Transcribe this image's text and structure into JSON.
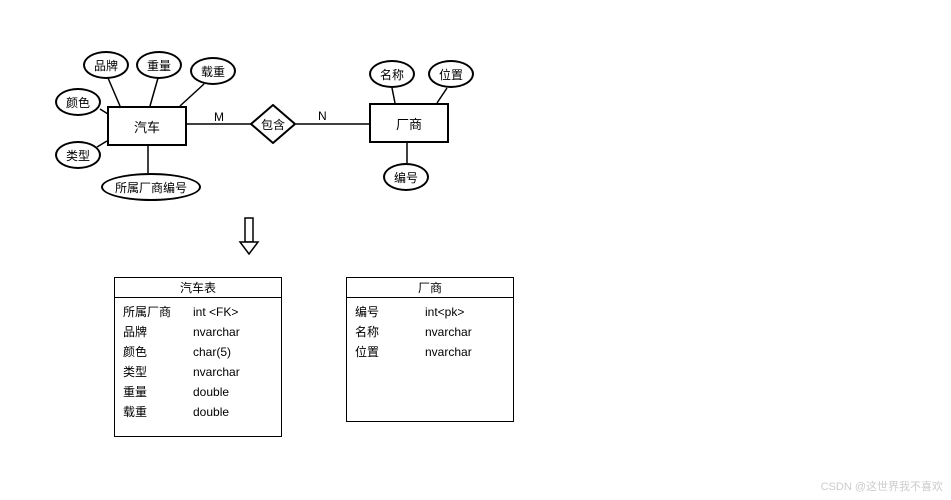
{
  "er": {
    "entities": {
      "car": "汽车",
      "vendor": "厂商"
    },
    "relationship": {
      "label": "包含",
      "left_card": "M",
      "right_card": "N"
    },
    "attrs": {
      "car": {
        "brand": "品牌",
        "weight": "重量",
        "capacity": "载重",
        "color": "颜色",
        "type": "类型",
        "vendor_fk": "所属厂商编号"
      },
      "vendor": {
        "name": "名称",
        "location": "位置",
        "id": "编号"
      }
    }
  },
  "tables": {
    "car": {
      "title": "汽车表",
      "cols": [
        {
          "name": "所属厂商",
          "type": "int   <FK>"
        },
        {
          "name": "品牌",
          "type": "nvarchar"
        },
        {
          "name": "颜色",
          "type": "char(5)"
        },
        {
          "name": "类型",
          "type": " nvarchar"
        },
        {
          "name": "重量",
          "type": "double"
        },
        {
          "name": "载重",
          "type": "double"
        }
      ]
    },
    "vendor": {
      "title": "厂商",
      "cols": [
        {
          "name": "编号",
          "type": "int<pk>"
        },
        {
          "name": "名称",
          "type": "nvarchar"
        },
        {
          "name": "位置",
          "type": "nvarchar"
        }
      ]
    }
  },
  "watermark": "CSDN @这世界我不喜欢"
}
